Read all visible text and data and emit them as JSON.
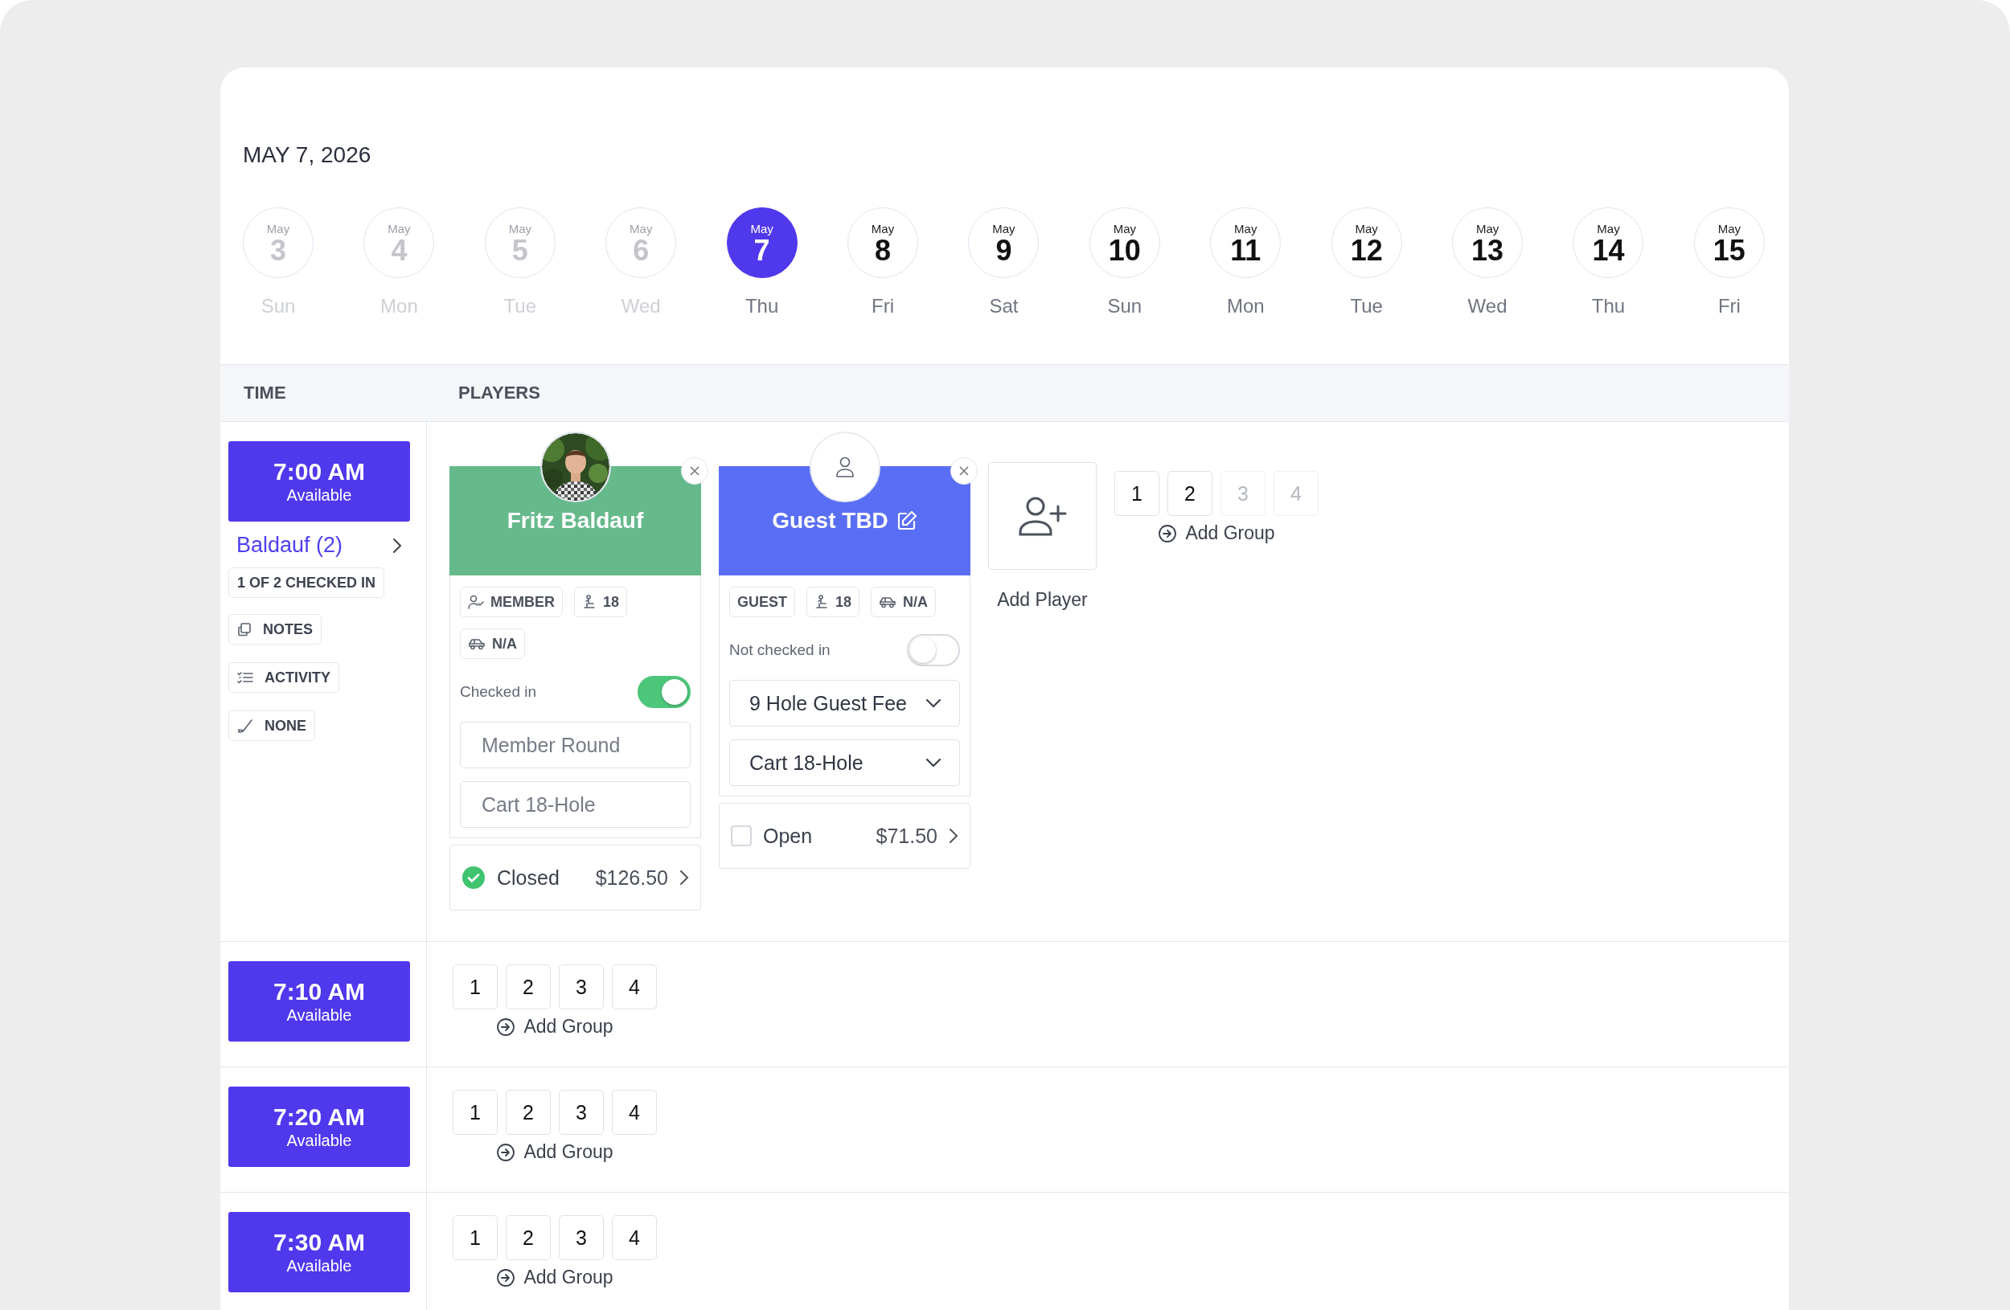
{
  "header": {
    "date": "MAY 7, 2026"
  },
  "dates": [
    {
      "month": "May",
      "day": "3",
      "weekday": "Sun",
      "disabled": true,
      "selected": false
    },
    {
      "month": "May",
      "day": "4",
      "weekday": "Mon",
      "disabled": true,
      "selected": false
    },
    {
      "month": "May",
      "day": "5",
      "weekday": "Tue",
      "disabled": true,
      "selected": false
    },
    {
      "month": "May",
      "day": "6",
      "weekday": "Wed",
      "disabled": true,
      "selected": false
    },
    {
      "month": "May",
      "day": "7",
      "weekday": "Thu",
      "disabled": false,
      "selected": true
    },
    {
      "month": "May",
      "day": "8",
      "weekday": "Fri",
      "disabled": false,
      "selected": false
    },
    {
      "month": "May",
      "day": "9",
      "weekday": "Sat",
      "disabled": false,
      "selected": false
    },
    {
      "month": "May",
      "day": "10",
      "weekday": "Sun",
      "disabled": false,
      "selected": false
    },
    {
      "month": "May",
      "day": "11",
      "weekday": "Mon",
      "disabled": false,
      "selected": false
    },
    {
      "month": "May",
      "day": "12",
      "weekday": "Tue",
      "disabled": false,
      "selected": false
    },
    {
      "month": "May",
      "day": "13",
      "weekday": "Wed",
      "disabled": false,
      "selected": false
    },
    {
      "month": "May",
      "day": "14",
      "weekday": "Thu",
      "disabled": false,
      "selected": false
    },
    {
      "month": "May",
      "day": "15",
      "weekday": "Fri",
      "disabled": false,
      "selected": false
    }
  ],
  "columns": [
    "TIME",
    "PLAYERS"
  ],
  "tee_times": [
    {
      "time": "7:00 AM",
      "status": "Available",
      "group_name": "Baldauf (2)",
      "checkin_summary": "1 OF 2 CHECKED IN",
      "actions": [
        {
          "kind": "notes",
          "label": "NOTES"
        },
        {
          "kind": "activity",
          "label": "ACTIVITY"
        },
        {
          "kind": "club",
          "label": "NONE"
        }
      ],
      "players": [
        {
          "name": "Fritz Baldauf",
          "color": "#66b98b",
          "has_photo": true,
          "editable": false,
          "tags": [
            {
              "kind": "member",
              "label": "MEMBER"
            },
            {
              "kind": "holes",
              "label": "18"
            },
            {
              "kind": "cart",
              "label": "N/A"
            }
          ],
          "check_in_label": "Checked in",
          "checked_in": true,
          "fields": [
            {
              "value": "Member Round",
              "disabled": true
            },
            {
              "value": "Cart 18-Hole",
              "disabled": true
            }
          ],
          "payment": {
            "status": "Closed",
            "paid": true,
            "amount": "$126.50"
          }
        },
        {
          "name": "Guest TBD",
          "color": "#5a6ef5",
          "has_photo": false,
          "editable": true,
          "tags": [
            {
              "kind": "plain",
              "label": "GUEST"
            },
            {
              "kind": "holes",
              "label": "18"
            },
            {
              "kind": "cart",
              "label": "N/A"
            }
          ],
          "check_in_label": "Not checked in",
          "checked_in": false,
          "fields": [
            {
              "value": "9 Hole Guest Fee",
              "disabled": false
            },
            {
              "value": "Cart 18-Hole",
              "disabled": false
            }
          ],
          "payment": {
            "status": "Open",
            "paid": false,
            "amount": "$71.50"
          }
        }
      ],
      "add_player": "Add Player",
      "groups": [
        {
          "label": "1",
          "disabled": false
        },
        {
          "label": "2",
          "disabled": false
        },
        {
          "label": "3",
          "disabled": true
        },
        {
          "label": "4",
          "disabled": true
        }
      ],
      "add_group": "Add Group"
    },
    {
      "time": "7:10 AM",
      "status": "Available",
      "groups": [
        {
          "label": "1",
          "disabled": false
        },
        {
          "label": "2",
          "disabled": false
        },
        {
          "label": "3",
          "disabled": false
        },
        {
          "label": "4",
          "disabled": false
        }
      ],
      "add_group": "Add Group"
    },
    {
      "time": "7:20 AM",
      "status": "Available",
      "groups": [
        {
          "label": "1",
          "disabled": false
        },
        {
          "label": "2",
          "disabled": false
        },
        {
          "label": "3",
          "disabled": false
        },
        {
          "label": "4",
          "disabled": false
        }
      ],
      "add_group": "Add Group"
    },
    {
      "time": "7:30 AM",
      "status": "Available",
      "groups": [
        {
          "label": "1",
          "disabled": false
        },
        {
          "label": "2",
          "disabled": false
        },
        {
          "label": "3",
          "disabled": false
        },
        {
          "label": "4",
          "disabled": false
        }
      ],
      "add_group": "Add Group"
    }
  ]
}
